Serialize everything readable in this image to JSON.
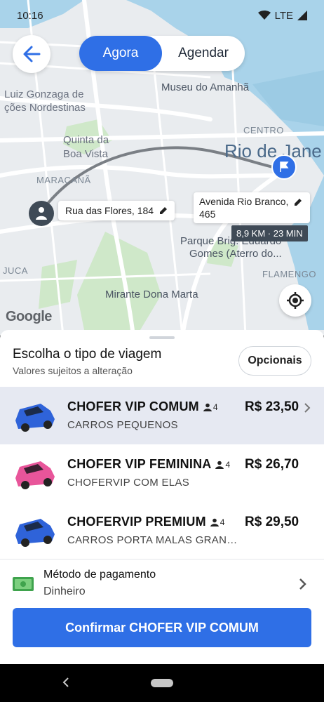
{
  "status_bar": {
    "time": "10:16",
    "network": "LTE"
  },
  "top": {
    "segment": {
      "now": "Agora",
      "schedule": "Agendar"
    }
  },
  "map": {
    "labels": {
      "museum": "Museu do Amanhã",
      "luiz_line1": "Luiz Gonzaga de",
      "luiz_line2": "ções Nordestinas",
      "quinta_line1": "Quinta da",
      "quinta_line2": "Boa Vista",
      "maracana": "MARACANÃ",
      "centro": "CENTRO",
      "rio": "Rio de Jane",
      "parque_line1": "Parque Brig. Eduardo",
      "parque_line2": "Gomes (Aterro do...",
      "juca": "JUCA",
      "flamengo": "FLAMENGO",
      "mirante": "Mirante Dona Marta",
      "google": "Google"
    },
    "origin": "Rua das Flores, 184",
    "destination_line1": "Avenida Rio Branco,",
    "destination_line2": "465",
    "eta": "8,9 KM · 23 MIN"
  },
  "sheet": {
    "title": "Escolha o tipo de viagem",
    "subtitle": "Valores sujeitos a alteração",
    "options_button": "Opcionais",
    "rides": [
      {
        "name": "CHOFER VIP COMUM",
        "pax": "4",
        "desc": "CARROS PEQUENOS",
        "price": "R$ 23,50",
        "color": "#2f63d9",
        "selected": true
      },
      {
        "name": "CHOFER VIP FEMININA",
        "pax": "4",
        "desc": "CHOFERVIP COM ELAS",
        "price": "R$ 26,70",
        "color": "#e8559a",
        "selected": false
      },
      {
        "name": "CHOFERVIP PREMIUM",
        "pax": "4",
        "desc": "CARROS PORTA MALAS GRANDES",
        "price": "R$ 29,50",
        "color": "#2f63d9",
        "selected": false
      }
    ],
    "payment": {
      "label": "Método de pagamento",
      "value": "Dinheiro"
    },
    "confirm_button": "Confirmar CHOFER VIP COMUM"
  },
  "colors": {
    "accent": "#2f6fe6",
    "water": "#a9d3ea",
    "park": "#cfe8c9"
  }
}
